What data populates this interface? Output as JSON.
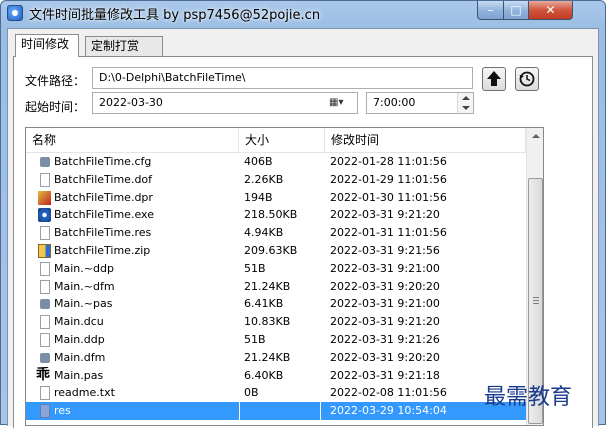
{
  "window": {
    "title": "文件时间批量修改工具 by psp7456@52pojie.cn",
    "controls": {
      "minimize": "–",
      "maximize": "□",
      "close": "✕"
    }
  },
  "tabs": [
    {
      "label": "时间修改",
      "active": true
    },
    {
      "label": "定制打赏",
      "active": false
    }
  ],
  "form": {
    "path_label": "文件路径：",
    "path_value": "D:\\0-Delphi\\BatchFileTime\\",
    "start_label": "起始时间：",
    "date_value": "2022-03-30",
    "time_value": "7:00:00"
  },
  "list": {
    "columns": {
      "name": "名称",
      "size": "大小",
      "modified": "修改时间"
    },
    "rows": [
      {
        "name": "BatchFileTime.cfg",
        "size": "406B",
        "modified": "2022-01-28 11:01:56",
        "icon": "gear-file-icon",
        "selected": false
      },
      {
        "name": "BatchFileTime.dof",
        "size": "2.26KB",
        "modified": "2022-01-29 11:01:56",
        "icon": "document-icon",
        "selected": false
      },
      {
        "name": "BatchFileTime.dpr",
        "size": "194B",
        "modified": "2022-01-30 11:01:56",
        "icon": "delphi-project-icon",
        "selected": false
      },
      {
        "name": "BatchFileTime.exe",
        "size": "218.50KB",
        "modified": "2022-03-31 9:21:20",
        "icon": "executable-icon",
        "selected": false
      },
      {
        "name": "BatchFileTime.res",
        "size": "4.94KB",
        "modified": "2022-01-31 11:01:56",
        "icon": "document-icon",
        "selected": false
      },
      {
        "name": "BatchFileTime.zip",
        "size": "209.63KB",
        "modified": "2022-03-31 9:21:56",
        "icon": "archive-icon",
        "selected": false
      },
      {
        "name": "Main.~ddp",
        "size": "51B",
        "modified": "2022-03-31 9:21:00",
        "icon": "document-icon",
        "selected": false
      },
      {
        "name": "Main.~dfm",
        "size": "21.24KB",
        "modified": "2022-03-31 9:20:20",
        "icon": "document-icon",
        "selected": false
      },
      {
        "name": "Main.~pas",
        "size": "6.41KB",
        "modified": "2022-03-31 9:21:00",
        "icon": "gear-file-icon",
        "selected": false
      },
      {
        "name": "Main.dcu",
        "size": "10.83KB",
        "modified": "2022-03-31 9:21:20",
        "icon": "document-icon",
        "selected": false
      },
      {
        "name": "Main.ddp",
        "size": "51B",
        "modified": "2022-03-31 9:21:26",
        "icon": "document-icon",
        "selected": false
      },
      {
        "name": "Main.dfm",
        "size": "21.24KB",
        "modified": "2022-03-31 9:20:20",
        "icon": "gear-file-icon",
        "selected": false
      },
      {
        "name": "Main.pas",
        "size": "6.40KB",
        "modified": "2022-03-31 9:21:18",
        "icon": "pascal-source-icon",
        "selected": false
      },
      {
        "name": "readme.txt",
        "size": "0B",
        "modified": "2022-02-08 11:01:56",
        "icon": "document-icon",
        "selected": false
      },
      {
        "name": "res",
        "size": "",
        "modified": "2022-03-29 10:54:04",
        "icon": "folder-icon",
        "selected": true
      }
    ]
  },
  "watermark": "最需教育",
  "colors": {
    "selection": "#3399ff",
    "titlebar": "#a9c8ea",
    "close": "#c23a22",
    "watermark": "#1a3a8c"
  }
}
